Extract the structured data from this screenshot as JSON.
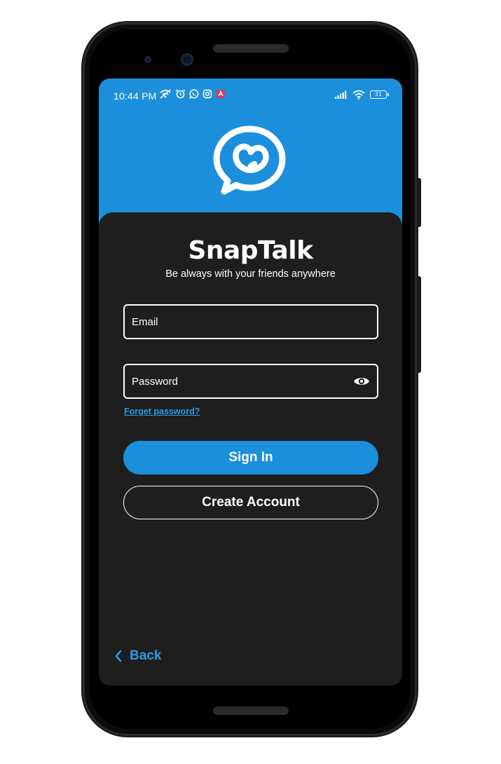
{
  "status_bar": {
    "time": "10:44 PM",
    "battery": "31",
    "left_icons": [
      "wifi-off-icon",
      "alarm-icon",
      "whatsapp-icon",
      "instagram-icon",
      "app-notification-icon"
    ],
    "right_icons": [
      "signal-icon",
      "wifi-icon",
      "battery-icon"
    ]
  },
  "header": {
    "logo_icon": "chat-heart-logo-icon",
    "background_color": "#1b8fdb"
  },
  "login": {
    "title": "SnapTalk",
    "subtitle": "Be always with your friends anywhere",
    "email_placeholder": "Email",
    "password_placeholder": "Password",
    "password_toggle_icon": "eye-icon",
    "forgot_password": "Forget password? ",
    "signin_label": "Sign In",
    "create_account_label": "Create Account",
    "back_label": "Back",
    "back_icon": "chevron-left-icon"
  },
  "colors": {
    "accent": "#1b8fdb",
    "link": "#2b9be6",
    "card_background": "#1e1e1e",
    "text": "#ffffff"
  }
}
